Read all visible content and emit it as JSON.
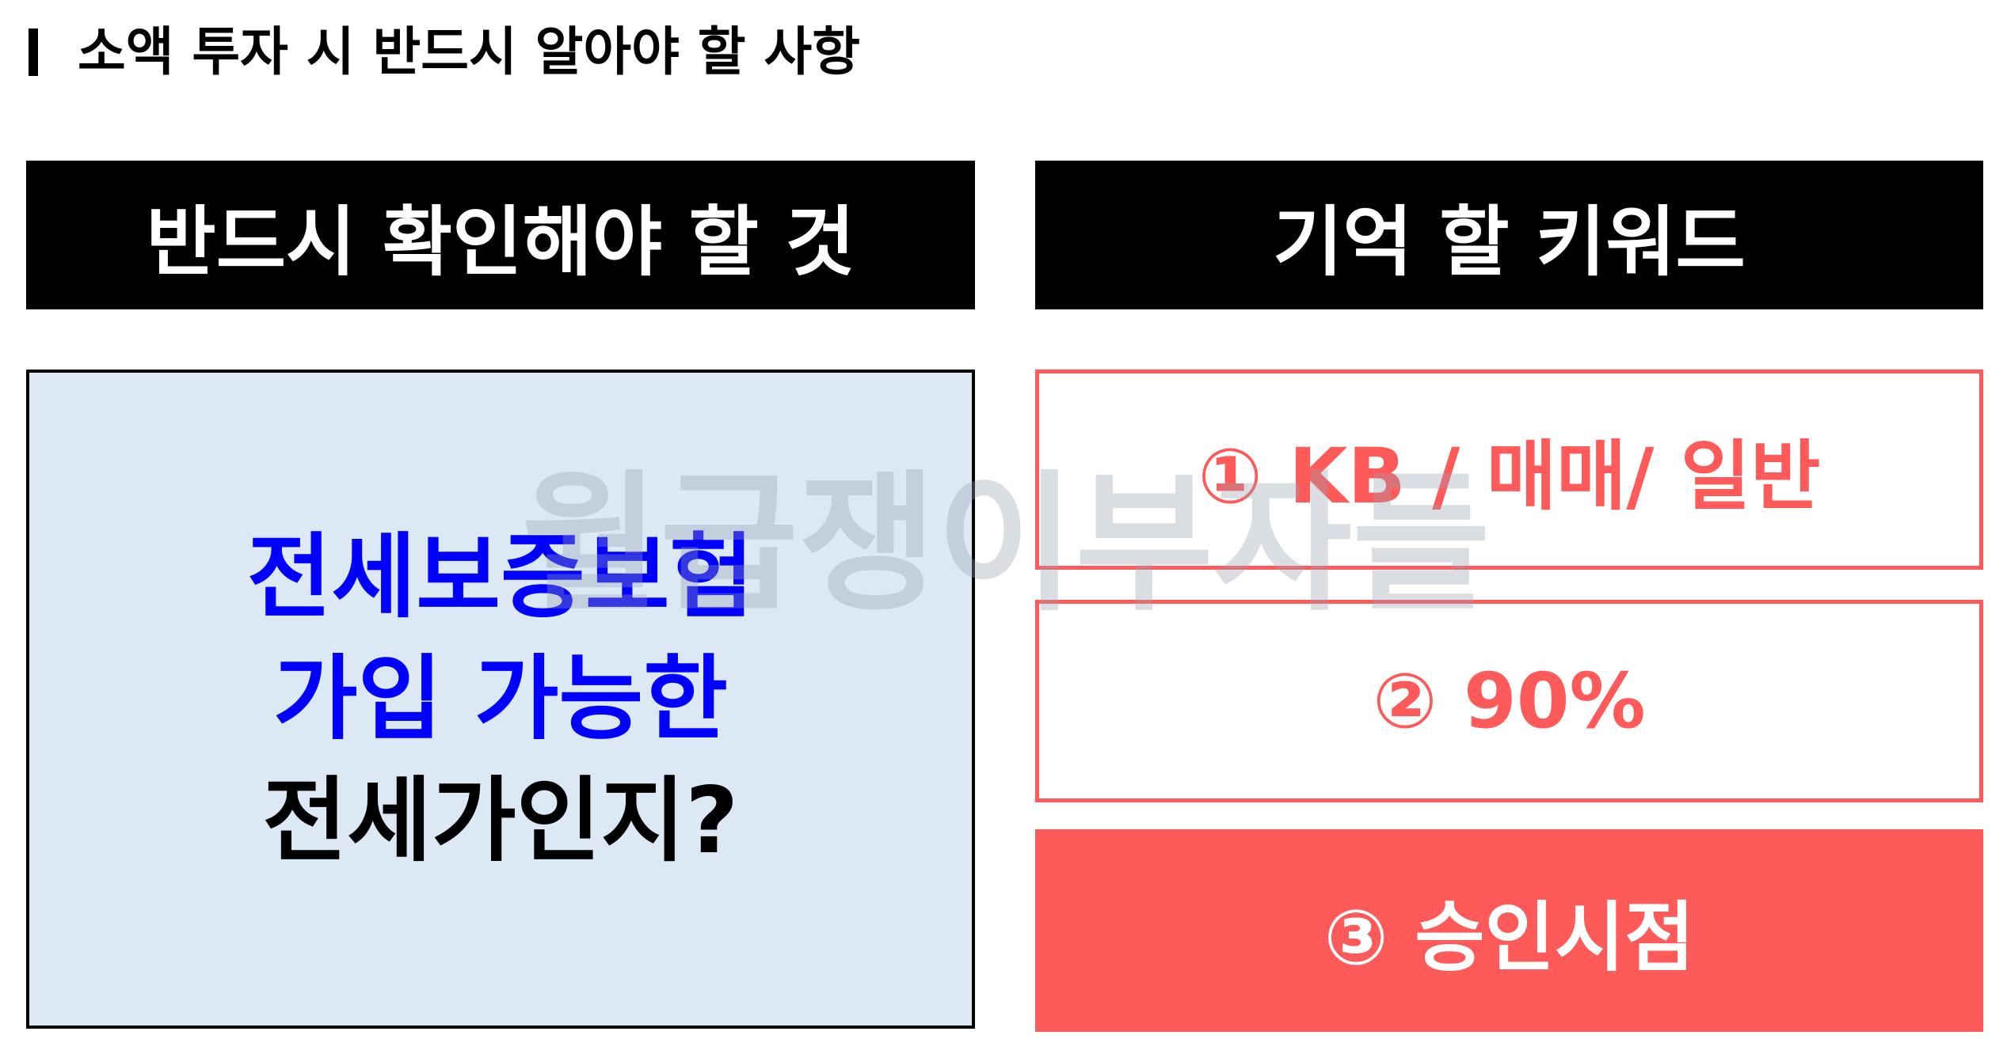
{
  "page": {
    "title": "소액 투자 시 반드시 알아야 할 사항"
  },
  "headers": {
    "left": "반드시 확인해야 할 것",
    "right": "기억 할 키워드"
  },
  "check_box": {
    "line1": "전세보증보험",
    "line2": "가입 가능한",
    "line3": "전세가인지?"
  },
  "keywords": [
    {
      "label": "① KB / 매매/ 일반"
    },
    {
      "label": "② 90%"
    },
    {
      "label": "③ 승인시점"
    }
  ],
  "watermark": "월급쟁이부자들",
  "colors": {
    "accent": "#ff5a5a",
    "highlight_text": "#0000ff",
    "box_background": "#dce8f4",
    "header_background": "#000000"
  }
}
